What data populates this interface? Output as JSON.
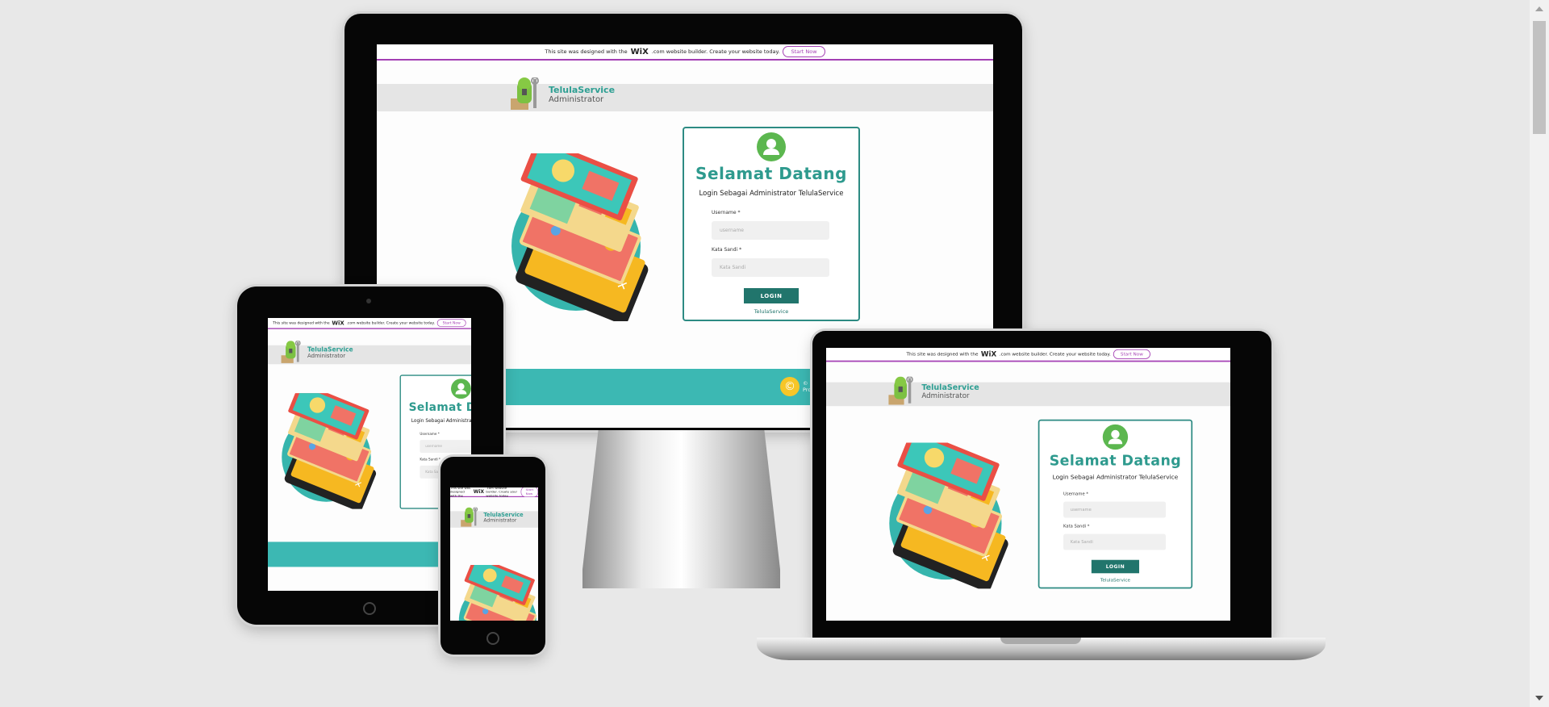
{
  "wix_banner": {
    "text_before": "This site was designed with the",
    "wix": "WiX",
    "text_after": ".com website builder. Create your website today.",
    "start_now": "Start Now"
  },
  "header": {
    "brand": "TelulaService",
    "role": "Administrator"
  },
  "login": {
    "title": "Selamat Datang",
    "subtitle": "Login Sebagai Administrator TelulaService",
    "username_label": "Username *",
    "username_placeholder": "username",
    "password_label": "Kata Sandi *",
    "password_placeholder": "Kata Sandi",
    "login_button": "LOGIN",
    "link": "TelulaService"
  },
  "footer": {
    "copyright_symbol": "©",
    "line1": "© by Te",
    "line2": "Proudly"
  },
  "colors": {
    "accent": "#2e9a8e",
    "button": "#21756c",
    "footer": "#3cb8b3",
    "wix_purple": "#a43fb4",
    "avatar": "#5cb74f"
  }
}
